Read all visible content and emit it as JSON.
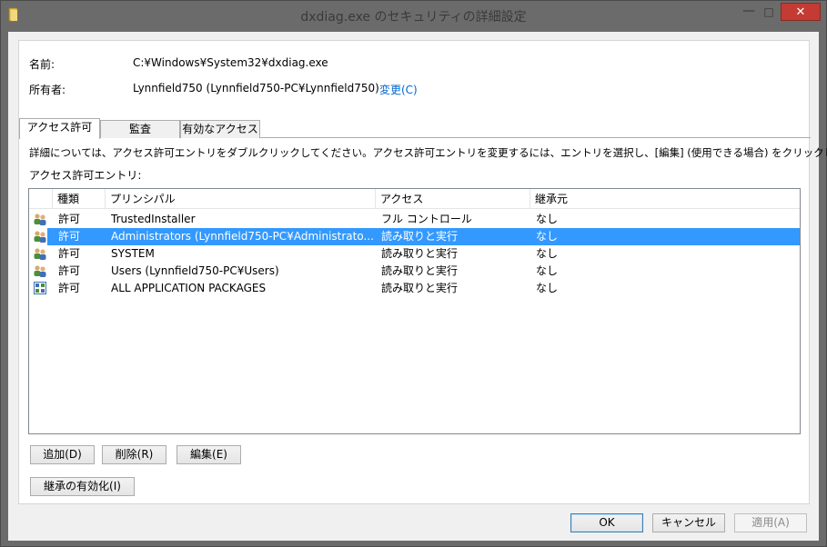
{
  "window": {
    "title": "dxdiag.exe のセキュリティの詳細設定",
    "min_glyph": "—",
    "max_glyph": "□",
    "close_glyph": "✕"
  },
  "info": {
    "name_label": "名前:",
    "name_value": "C:¥Windows¥System32¥dxdiag.exe",
    "owner_label": "所有者:",
    "owner_value": "Lynnfield750 (Lynnfield750-PC¥Lynnfield750)",
    "change_link": "変更(C)"
  },
  "tabs": [
    {
      "label": "アクセス許可",
      "active": true
    },
    {
      "label": "監査",
      "active": false
    },
    {
      "label": "有効なアクセス",
      "active": false
    }
  ],
  "instructions": "詳細については、アクセス許可エントリをダブルクリックしてください。アクセス許可エントリを変更するには、エントリを選択し、[編集] (使用できる場合) をクリックします。",
  "entries_label": "アクセス許可エントリ:",
  "table": {
    "columns": [
      "種類",
      "プリンシパル",
      "アクセス",
      "継承元"
    ],
    "rows": [
      {
        "icon": "user-group-icon",
        "type": "許可",
        "principal": "TrustedInstaller",
        "access": "フル コントロール",
        "inherited": "なし",
        "selected": false
      },
      {
        "icon": "user-group-icon",
        "type": "許可",
        "principal": "Administrators (Lynnfield750-PC¥Administrato...",
        "access": "読み取りと実行",
        "inherited": "なし",
        "selected": true
      },
      {
        "icon": "user-group-icon",
        "type": "許可",
        "principal": "SYSTEM",
        "access": "読み取りと実行",
        "inherited": "なし",
        "selected": false
      },
      {
        "icon": "user-group-icon",
        "type": "許可",
        "principal": "Users (Lynnfield750-PC¥Users)",
        "access": "読み取りと実行",
        "inherited": "なし",
        "selected": false
      },
      {
        "icon": "app-package-icon",
        "type": "許可",
        "principal": "ALL APPLICATION PACKAGES",
        "access": "読み取りと実行",
        "inherited": "なし",
        "selected": false
      }
    ]
  },
  "buttons": {
    "add": "追加(D)",
    "remove": "削除(R)",
    "edit": "編集(E)",
    "enable_inheritance": "継承の有効化(I)",
    "ok": "OK",
    "cancel": "キャンセル",
    "apply": "適用(A)"
  },
  "colors": {
    "selection": "#3399ff",
    "close_button": "#c43b33",
    "link": "#0066cc"
  }
}
